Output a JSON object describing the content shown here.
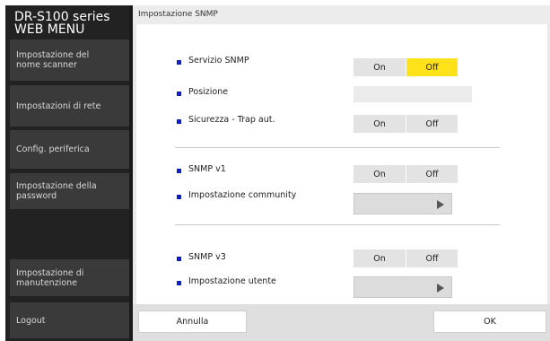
{
  "sidebar": {
    "brand_line1": "DR-S100 series",
    "brand_line2": "WEB MENU",
    "items": [
      {
        "line1": "Impostazione del",
        "line2": "nome scanner"
      },
      {
        "line1": "Impostazioni di rete",
        "line2": ""
      },
      {
        "line1": "Config. periferica",
        "line2": ""
      },
      {
        "line1": "Impostazione della",
        "line2": "password"
      },
      {
        "line1": "Impostazione di",
        "line2": "manutenzione"
      },
      {
        "line1": "Logout",
        "line2": ""
      }
    ]
  },
  "header": {
    "title": "Impostazione SNMP"
  },
  "settings": {
    "snmp_service": {
      "label": "Servizio SNMP",
      "on": "On",
      "off": "Off",
      "selected": "Off"
    },
    "position": {
      "label": "Posizione",
      "value": ""
    },
    "security_trap": {
      "label": "Sicurezza - Trap aut.",
      "on": "On",
      "off": "Off"
    },
    "snmp_v1": {
      "label": "SNMP v1",
      "on": "On",
      "off": "Off"
    },
    "community_setting": {
      "label": "Impostazione community"
    },
    "snmp_v3": {
      "label": "SNMP v3",
      "on": "On",
      "off": "Off"
    },
    "user_setting": {
      "label": "Impostazione utente"
    }
  },
  "footer": {
    "cancel_label": "Annulla",
    "ok_label": "OK"
  },
  "colors": {
    "accent": "#ffe21a",
    "bullet": "#0b1ec8",
    "sidebar_bg": "#222222"
  }
}
